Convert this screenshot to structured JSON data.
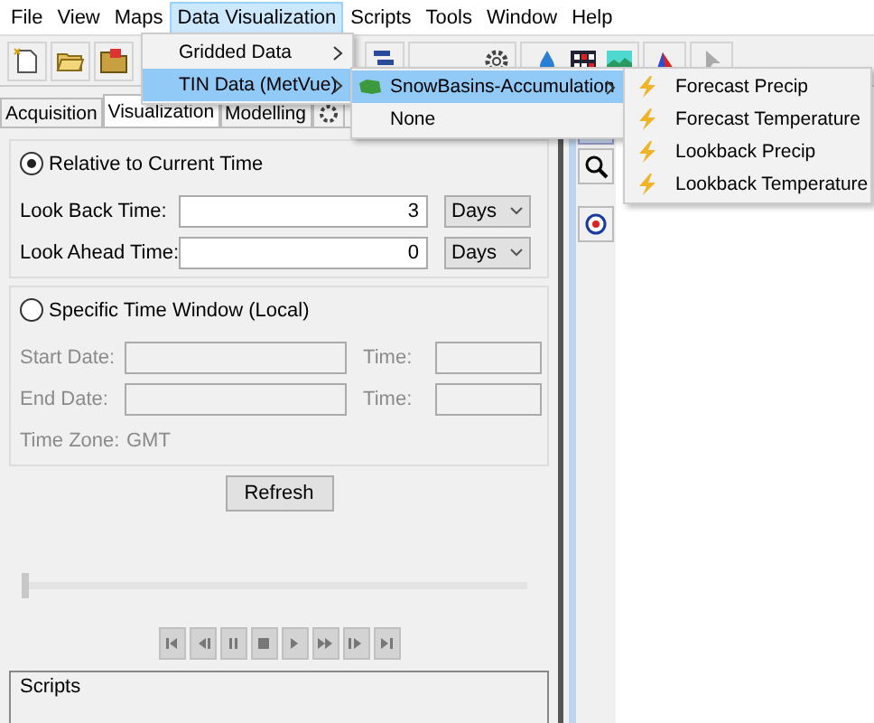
{
  "menu_bar": [
    {
      "label": "File",
      "selected": false
    },
    {
      "label": "View",
      "selected": false
    },
    {
      "label": "Maps",
      "selected": false
    },
    {
      "label": "Data Visualization",
      "selected": true
    },
    {
      "label": "Scripts",
      "selected": false
    },
    {
      "label": "Tools",
      "selected": false
    },
    {
      "label": "Window",
      "selected": false
    },
    {
      "label": "Help",
      "selected": false
    }
  ],
  "data_menu": [
    {
      "label": "Gridded Data",
      "selected": false
    },
    {
      "label": "TIN Data (MetVue)",
      "selected": true
    }
  ],
  "tin_menu": [
    {
      "label": "SnowBasins-Accumulation",
      "selected": true,
      "kind": "submenu"
    },
    {
      "label": "None",
      "selected": false,
      "kind": "plain"
    }
  ],
  "basin_menu": [
    {
      "label": "Forecast Precip",
      "selected": false
    },
    {
      "label": "Forecast Temperature",
      "selected": false
    },
    {
      "label": "Lookback Precip",
      "selected": false
    },
    {
      "label": "Lookback Temperature",
      "selected": false
    }
  ],
  "tabs": [
    {
      "label": "Acquisition",
      "selected": false
    },
    {
      "label": "Visualization",
      "selected": true
    },
    {
      "label": "Modelling",
      "selected": false
    }
  ],
  "relative": {
    "label": "Relative to Current Time",
    "selected": true,
    "fields": [
      {
        "label": "Look Back Time:",
        "value": "3",
        "unit": "Days"
      },
      {
        "label": "Look Ahead Time:",
        "value": "0",
        "unit": "Days"
      }
    ]
  },
  "specific": {
    "label": "Specific Time Window (Local)",
    "selected": false,
    "disabled": true,
    "rows": [
      {
        "label": "Start Date:",
        "time_label": "Time:"
      },
      {
        "label": "End Date:",
        "time_label": "Time:"
      }
    ],
    "time_zone_label": "Time Zone:",
    "time_zone": "GMT"
  },
  "refresh_button": "Refresh",
  "time_slider": {
    "level": 0
  },
  "scripts": {
    "title": "Scripts"
  }
}
